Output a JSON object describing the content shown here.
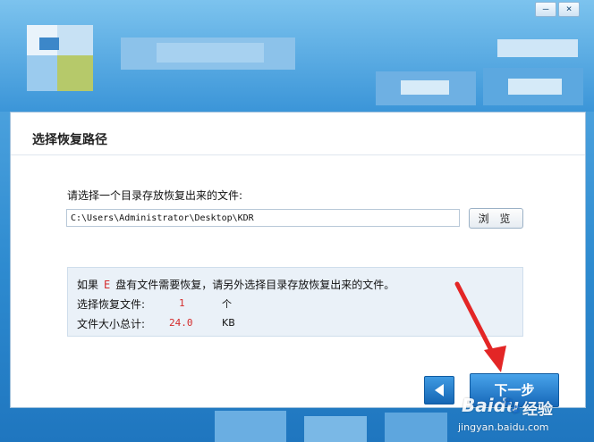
{
  "window": {
    "minimize_glyph": "—",
    "close_glyph": "×"
  },
  "panel": {
    "title": "选择恢复路径",
    "prompt": "请选择一个目录存放恢复出来的文件:",
    "path_value": "C:\\Users\\Administrator\\Desktop\\KDR",
    "browse_label": "浏 览"
  },
  "info": {
    "prefix": "如果",
    "drive": "E",
    "suffix": "盘有文件需要恢复，请另外选择目录存放恢复出来的文件。",
    "files_label": "选择恢复文件:",
    "files_count": "1",
    "files_unit": "个",
    "size_label": "文件大小总计:",
    "size_value": "24.0",
    "size_unit": "KB"
  },
  "nav": {
    "next_label": "下一步"
  },
  "watermark": {
    "logo": "Baidu",
    "paw": "🐾",
    "cn": "经验",
    "url": "jingyan.baidu.com"
  },
  "colors": {
    "accent": "#1e7fd0",
    "warning": "#d42b2b",
    "arrow": "#e32626"
  }
}
